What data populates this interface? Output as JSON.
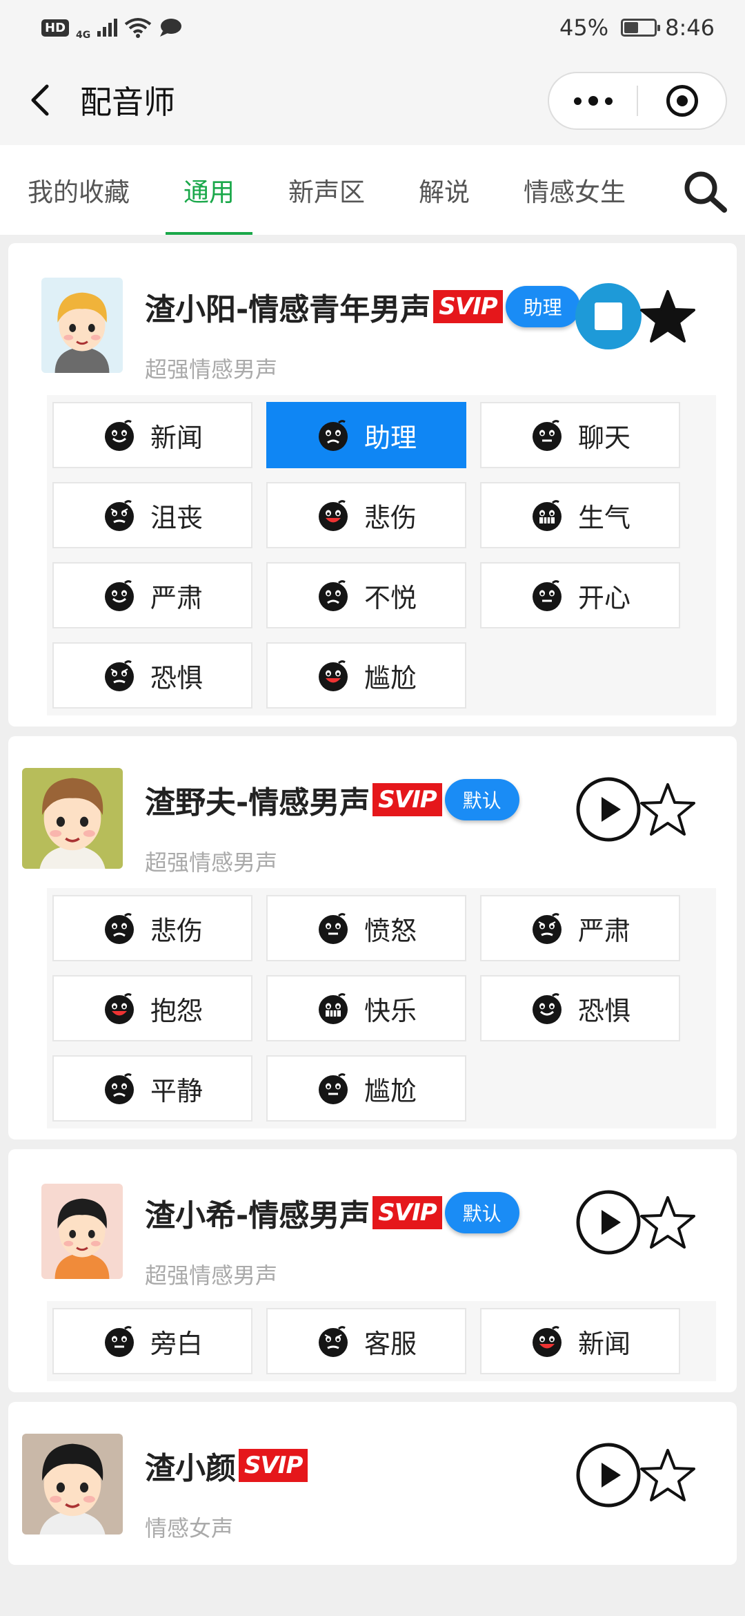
{
  "status_bar": {
    "hd": "HD",
    "network": "4G",
    "battery_text": "45%",
    "battery_level": 0.45,
    "time": "8:46"
  },
  "nav": {
    "title": "配音师",
    "back_icon": "chevron-left-icon",
    "more_icon": "more-dots-icon",
    "close_icon": "target-icon"
  },
  "tabs": [
    {
      "label": "我的收藏",
      "active": false
    },
    {
      "label": "通用",
      "active": true
    },
    {
      "label": "新声区",
      "active": false
    },
    {
      "label": "解说",
      "active": false
    },
    {
      "label": "情感女生",
      "active": false
    }
  ],
  "voices": [
    {
      "name": "渣小阳-情感青年男声",
      "svip": "SVIP",
      "tag": "助理",
      "desc": "超强情感男声",
      "playing": true,
      "favorited": true,
      "emotions": [
        {
          "label": "新闻",
          "selected": false
        },
        {
          "label": "助理",
          "selected": true
        },
        {
          "label": "聊天",
          "selected": false
        },
        {
          "label": "沮丧",
          "selected": false
        },
        {
          "label": "悲伤",
          "selected": false
        },
        {
          "label": "生气",
          "selected": false
        },
        {
          "label": "严肃",
          "selected": false
        },
        {
          "label": "不悦",
          "selected": false
        },
        {
          "label": "开心",
          "selected": false
        },
        {
          "label": "恐惧",
          "selected": false
        },
        {
          "label": "尴尬",
          "selected": false
        }
      ]
    },
    {
      "name": "渣野夫-情感男声",
      "svip": "SVIP",
      "tag": "默认",
      "desc": "超强情感男声",
      "playing": false,
      "favorited": false,
      "emotions": [
        {
          "label": "悲伤",
          "selected": false
        },
        {
          "label": "愤怒",
          "selected": false
        },
        {
          "label": "严肃",
          "selected": false
        },
        {
          "label": "抱怨",
          "selected": false
        },
        {
          "label": "快乐",
          "selected": false
        },
        {
          "label": "恐惧",
          "selected": false
        },
        {
          "label": "平静",
          "selected": false
        },
        {
          "label": "尴尬",
          "selected": false
        }
      ]
    },
    {
      "name": "渣小希-情感男声",
      "svip": "SVIP",
      "tag": "默认",
      "desc": "超强情感男声",
      "playing": false,
      "favorited": false,
      "emotions": [
        {
          "label": "旁白",
          "selected": false
        },
        {
          "label": "客服",
          "selected": false
        },
        {
          "label": "新闻",
          "selected": false
        }
      ]
    },
    {
      "name": "渣小颜",
      "svip": "SVIP",
      "tag": "",
      "desc": "情感女声",
      "playing": false,
      "favorited": false,
      "emotions": []
    }
  ],
  "colors": {
    "accent_green": "#1aa84a",
    "selected_blue": "#0f86f4",
    "svip_red": "#e5171b",
    "stop_blue": "#1e9ad8"
  }
}
